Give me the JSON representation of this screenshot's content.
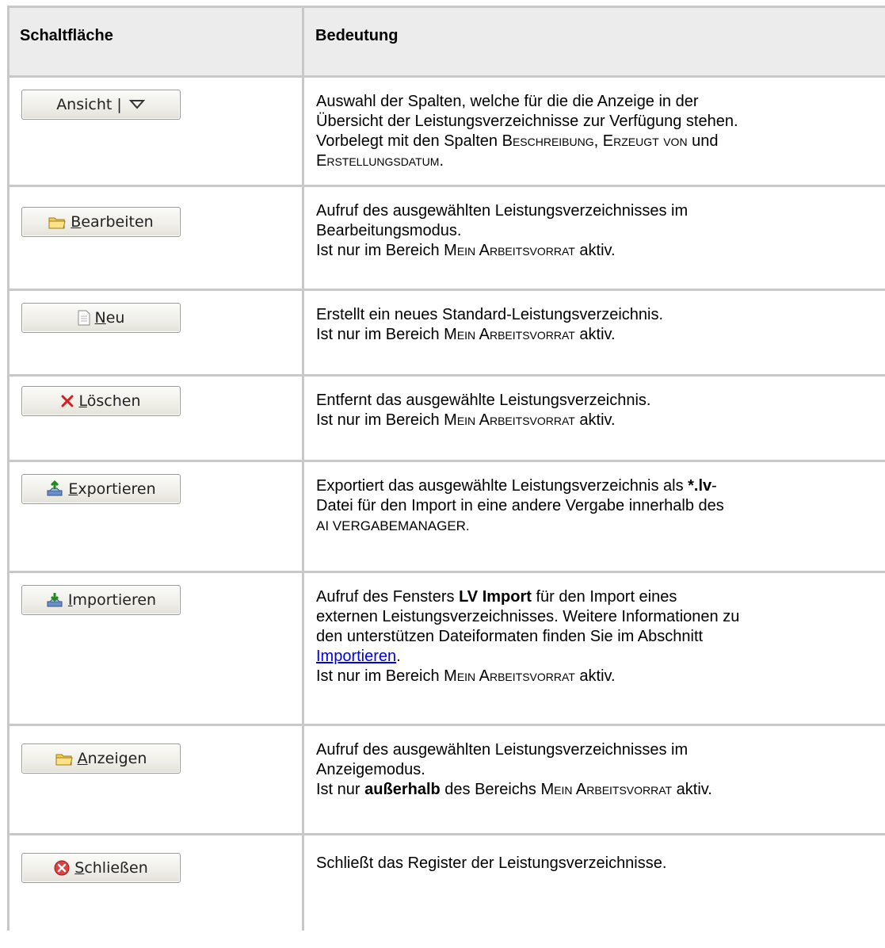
{
  "header": {
    "col1": "Schaltfläche",
    "col2": "Bedeutung"
  },
  "rows": [
    {
      "button": {
        "label": "Ansicht |",
        "icon": "dropdown-triangle-icon"
      },
      "lines": [
        "Auswahl der Spalten, welche für die die Anzeige in der",
        "Übersicht der Leistungsverzeichnisse zur Verfügung stehen.",
        "Vorbelegt mit den Spalten "
      ],
      "sc1": "Beschreibung",
      "sep1": ", ",
      "sc2": "Erzeugt von",
      "sep2": " und",
      "sc3": "Erstellungsdatum",
      "end": "."
    },
    {
      "button": {
        "key": "B",
        "rest": "earbeiten",
        "icon": "folder-icon"
      },
      "l1": "Aufruf des ausgewählten Leistungsverzeichnisses im",
      "l2": "Bearbeitungsmodus.",
      "l3a": "Ist nur im Bereich ",
      "sc": "Mein Arbeitsvorrat",
      "l3b": " aktiv."
    },
    {
      "button": {
        "key": "N",
        "rest": "eu",
        "icon": "new-document-icon"
      },
      "l1": "Erstellt ein neues Standard-Leistungsverzeichnis.",
      "l2a": "Ist nur im Bereich ",
      "sc": "Mein Arbeitsvorrat",
      "l2b": " aktiv."
    },
    {
      "button": {
        "key": "L",
        "rest": "öschen",
        "icon": "delete-x-icon"
      },
      "l1": "Entfernt das ausgewählte Leistungsverzeichnis.",
      "l2a": "Ist nur im Bereich ",
      "sc": "Mein Arbeitsvorrat",
      "l2b": " aktiv."
    },
    {
      "button": {
        "key": "E",
        "rest": "xportieren",
        "icon": "export-icon"
      },
      "l1a": "Exportiert das ausgewählte Leistungsverzeichnis als ",
      "l1b": "*.lv",
      "l1c": "-",
      "l2": "Datei für den Import in eine andere Vergabe innerhalb des",
      "l3": "AI VERGABEMANAGER."
    },
    {
      "button": {
        "key": "I",
        "rest": "mportieren",
        "icon": "import-icon"
      },
      "l1a": "Aufruf des Fensters ",
      "l1b": "LV Import",
      "l1c": " für den Import eines",
      "l2": "externen Leistungsverzeichnisses. Weitere Informationen zu",
      "l3": "den unterstützen Dateiformaten finden Sie im Abschnitt",
      "link": "Importieren",
      "linkEnd": ".",
      "l5a": "Ist nur im Bereich ",
      "sc": "Mein Arbeitsvorrat",
      "l5b": " aktiv."
    },
    {
      "button": {
        "key": "A",
        "rest": "nzeigen",
        "icon": "folder-icon"
      },
      "l1": "Aufruf des ausgewählten Leistungsverzeichnisses im",
      "l2": "Anzeigemodus.",
      "l3a": "Ist nur ",
      "l3b": "außerhalb",
      "l3c": " des Bereichs ",
      "sc": "Mein Arbeitsvorrat",
      "l3d": " aktiv."
    },
    {
      "button": {
        "key": "S",
        "rest": "chließen",
        "icon": "close-circle-icon"
      },
      "l1": "Schließt das Register der Leistungsverzeichnisse."
    }
  ]
}
